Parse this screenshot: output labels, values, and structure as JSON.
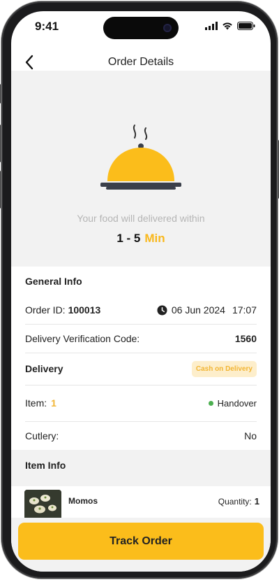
{
  "status_bar": {
    "time": "9:41"
  },
  "header": {
    "title": "Order Details"
  },
  "hero": {
    "message": "Your food will delivered within",
    "time_range": "1 - 5",
    "time_unit": "Min"
  },
  "general_info": {
    "title": "General Info",
    "order_id_label": "Order ID:",
    "order_id": "100013",
    "order_date": "06 Jun 2024",
    "order_time": "17:07",
    "verification_label": "Delivery Verification Code:",
    "verification_code": "1560",
    "delivery_label": "Delivery",
    "payment_badge": "Cash on Delivery",
    "item_label": "Item:",
    "item_count": "1",
    "order_status": "Handover",
    "cutlery_label": "Cutlery:",
    "cutlery_value": "No"
  },
  "item_info": {
    "title": "Item Info",
    "items": [
      {
        "name": "Momos",
        "quantity_label": "Quantity:",
        "quantity": "1"
      }
    ]
  },
  "actions": {
    "track_order": "Track Order"
  },
  "colors": {
    "accent": "#fbbd1b",
    "status_green": "#4caf50",
    "badge_bg": "#fdeecb"
  }
}
